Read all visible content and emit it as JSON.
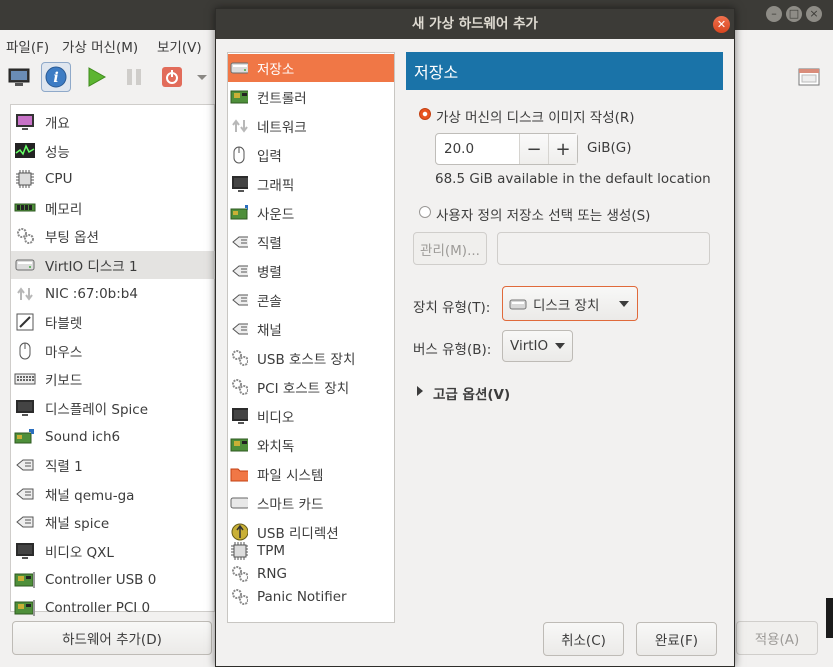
{
  "main_window": {
    "menu": [
      "파일(F)",
      "가상 머신(M)",
      "보기(V)"
    ],
    "sidebar_items": [
      {
        "label": "개요",
        "icon": "overview-monitor-icon"
      },
      {
        "label": "성능",
        "icon": "performance-graph-icon"
      },
      {
        "label": "CPU",
        "icon": "cpu-chip-icon"
      },
      {
        "label": "메모리",
        "icon": "memory-ram-icon"
      },
      {
        "label": "부팅 옵션",
        "icon": "boot-gears-icon"
      },
      {
        "label": "VirtIO 디스크 1",
        "icon": "disk-drive-icon"
      },
      {
        "label": "NIC :67:0b:b4",
        "icon": "network-arrows-icon"
      },
      {
        "label": "타블렛",
        "icon": "tablet-icon"
      },
      {
        "label": "마우스",
        "icon": "mouse-icon"
      },
      {
        "label": "키보드",
        "icon": "keyboard-icon"
      },
      {
        "label": "디스플레이 Spice",
        "icon": "display-monitor-icon"
      },
      {
        "label": "Sound ich6",
        "icon": "sound-card-icon"
      },
      {
        "label": "직렬 1",
        "icon": "serial-port-icon"
      },
      {
        "label": "채널 qemu-ga",
        "icon": "channel-icon"
      },
      {
        "label": "채널 spice",
        "icon": "channel-icon"
      },
      {
        "label": "비디오 QXL",
        "icon": "video-monitor-icon"
      },
      {
        "label": "Controller USB 0",
        "icon": "controller-card-icon"
      },
      {
        "label": "Controller PCI 0",
        "icon": "controller-card-icon"
      }
    ],
    "selected_sidebar_index": 5,
    "add_hardware_label": "하드웨어 추가(D)",
    "apply_label": "적용(A)"
  },
  "dialog": {
    "title": "새 가상 하드웨어 추가",
    "hw_items": [
      {
        "label": "저장소",
        "icon": "storage-disk-icon"
      },
      {
        "label": "컨트롤러",
        "icon": "controller-card-icon"
      },
      {
        "label": "네트워크",
        "icon": "network-arrows-icon"
      },
      {
        "label": "입력",
        "icon": "mouse-icon"
      },
      {
        "label": "그래픽",
        "icon": "graphics-monitor-icon"
      },
      {
        "label": "사운드",
        "icon": "sound-card-icon"
      },
      {
        "label": "직렬",
        "icon": "serial-port-icon"
      },
      {
        "label": "병렬",
        "icon": "parallel-port-icon"
      },
      {
        "label": "콘솔",
        "icon": "console-port-icon"
      },
      {
        "label": "채널",
        "icon": "channel-icon"
      },
      {
        "label": "USB 호스트 장치",
        "icon": "usb-gears-icon"
      },
      {
        "label": "PCI 호스트 장치",
        "icon": "pci-gears-icon"
      },
      {
        "label": "비디오",
        "icon": "video-monitor-icon"
      },
      {
        "label": "와치독",
        "icon": "watchdog-card-icon"
      },
      {
        "label": "파일 시스템",
        "icon": "folder-icon"
      },
      {
        "label": "스마트 카드",
        "icon": "smartcard-icon"
      },
      {
        "label": "USB 리디렉션",
        "icon": "usb-redirect-icon"
      },
      {
        "label": "TPM",
        "icon": "tpm-chip-icon"
      },
      {
        "label": "RNG",
        "icon": "rng-gears-icon"
      },
      {
        "label": "Panic Notifier",
        "icon": "panic-gears-icon"
      }
    ],
    "selected_hw_index": 0,
    "section_title": "저장소",
    "create_disk_label": "가상 머신의 디스크 이미지 작성(R)",
    "disk_size": "20.0",
    "size_unit": "GiB(G)",
    "available_text": "68.5 GiB available in the default location",
    "custom_storage_label": "사용자 정의 저장소 선택 또는 생성(S)",
    "manage_label": "관리(M)...",
    "device_type_label": "장치 유형(T):",
    "device_type_value": "디스크 장치",
    "bus_type_label": "버스 유형(B):",
    "bus_type_value": "VirtIO",
    "advanced_label": "고급 옵션(V)",
    "cancel_label": "취소(C)",
    "finish_label": "완료(F)",
    "minus": "−",
    "plus": "+"
  },
  "colors": {
    "accent": "#e95420",
    "header_blue": "#1a73a8",
    "titlebar": "#3c3b37"
  }
}
